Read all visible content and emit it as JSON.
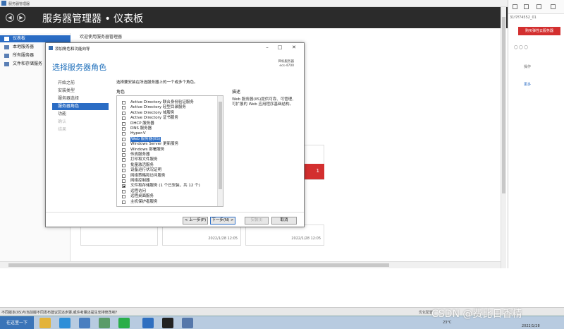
{
  "window": {
    "title": "服务器管理器"
  },
  "header": {
    "title": "服务器管理器 • 仪表板"
  },
  "sidebar": {
    "items": [
      {
        "label": "仪表板"
      },
      {
        "label": "本地服务器"
      },
      {
        "label": "所有服务器"
      },
      {
        "label": "文件和存储服务"
      }
    ]
  },
  "main": {
    "welcome": "欢迎使用服务器管理器",
    "tiles": [
      {
        "timestamp": "2022/1/28 12:05"
      },
      {
        "timestamp": "2022/1/28 12:05"
      }
    ],
    "red_tile_count": "1"
  },
  "right_panel": {
    "id_text": "31f7f74552_01",
    "button": "购买弹性云服务器",
    "col_header": "操作",
    "more": "更多"
  },
  "dialog": {
    "title": "添加角色和功能向导",
    "heading": "选择服务器角色",
    "target_label": "目标服务器",
    "target_name": "ecs-4700",
    "steps": [
      {
        "label": "开始之前"
      },
      {
        "label": "安装类型"
      },
      {
        "label": "服务器选择"
      },
      {
        "label": "服务器角色"
      },
      {
        "label": "功能"
      },
      {
        "label": "确认"
      },
      {
        "label": "结果"
      }
    ],
    "instruction": "选择要安装在所选服务器上的一个或多个角色。",
    "roles_header": "角色",
    "desc_header": "描述",
    "description": "Web 服务器(IIS)提供可靠、可管理、可扩展的 Web 应用程序基础结构。",
    "roles": [
      {
        "label": "Active Directory 联合身份验证服务"
      },
      {
        "label": "Active Directory 轻型目录服务"
      },
      {
        "label": "Active Directory 域服务"
      },
      {
        "label": "Active Directory 证书服务"
      },
      {
        "label": "DHCP 服务器"
      },
      {
        "label": "DNS 服务器"
      },
      {
        "label": "Hyper-V"
      },
      {
        "label": "Web 服务器(IIS)"
      },
      {
        "label": "Windows Server 更新服务"
      },
      {
        "label": "Windows 部署服务"
      },
      {
        "label": "传真服务器"
      },
      {
        "label": "打印和文件服务"
      },
      {
        "label": "批量激活服务"
      },
      {
        "label": "设备运行状况证明"
      },
      {
        "label": "网络策略和访问服务"
      },
      {
        "label": "网络控制器"
      },
      {
        "label": "文件和存储服务 (1 个已安装，共 12 个)"
      },
      {
        "label": "远程访问"
      },
      {
        "label": "远程桌面服务"
      },
      {
        "label": "主机保护者服务"
      }
    ],
    "buttons": {
      "prev": "< 上一步(P)",
      "next": "下一步(N) >",
      "install": "安装(I)",
      "cancel": "取消"
    }
  },
  "message_bar": {
    "text": "不同版本(IIS)与当前版不同发布建议区还步骤,或许考量还是生安排修改吧？",
    "right": "优化配置"
  },
  "taskbar": {
    "start": "在这里一下",
    "temperature": "23°C",
    "date": "2022/1/28"
  },
  "watermark": "CSDN @费比日香精"
}
